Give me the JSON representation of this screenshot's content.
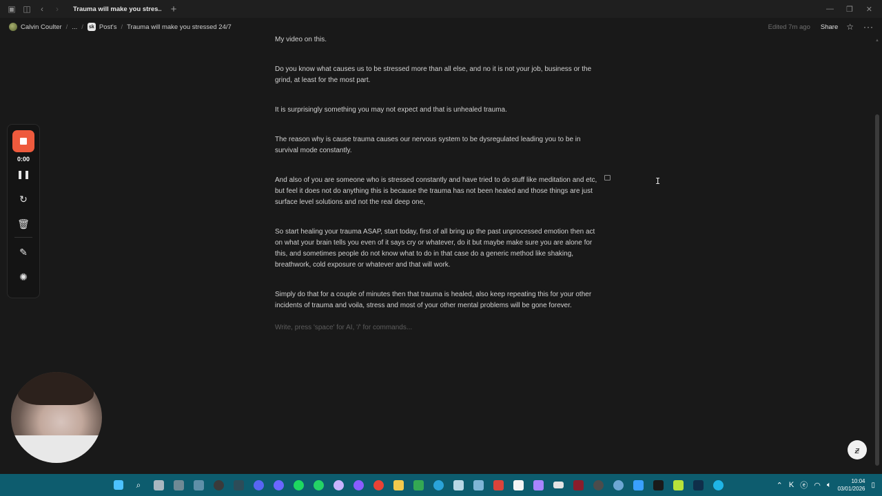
{
  "browser": {
    "tab_title": "Trauma will make you stres...",
    "new_tab_glyph": "+"
  },
  "breadcrumb": {
    "workspace": "Calvin Coulter",
    "ellipsis": "...",
    "parent": "Post's",
    "parent_badge": "sk",
    "current": "Trauma will make you stressed 24/7"
  },
  "topbar": {
    "edited": "Edited 7m ago",
    "share": "Share"
  },
  "document": {
    "paragraphs": [
      "My video on this.",
      "Do you know what causes us to be stressed more than all else, and no it is not your job, business or the grind, at least for the most part.",
      "It is surprisingly something you may not expect and that is unhealed trauma.",
      "The reason why is cause trauma causes our nervous system to be dysregulated leading you to be in survival mode constantly.",
      "And also of you are someone who is stressed constantly and have tried to do stuff like meditation and etc, but feel it does not do anything this is because the trauma has not been healed and those things are just surface level solutions and not the real deep one,",
      "So start healing your trauma ASAP, start today, first of all bring up the past unprocessed emotion then act on what your brain tells you even of it says cry or whatever, do it but maybe make sure you are alone for this, and sometimes people do not know what to do in that case do a generic method like shaking, breathwork, cold exposure or whatever and that will work.",
      "Simply do that for a couple of minutes then that trauma is healed, also keep repeating this for your other incidents of trauma and voila, stress and most of your other mental problems will be gone forever."
    ],
    "placeholder": "Write, press 'space' for AI, '/' for commands..."
  },
  "recorder": {
    "time": "0:00"
  },
  "taskbar": {
    "time": "10:04",
    "date": "03/01/2026"
  },
  "colors": {
    "background": "#191919",
    "record_accent": "#ee5a3d",
    "taskbar": "#0d5c6e"
  }
}
